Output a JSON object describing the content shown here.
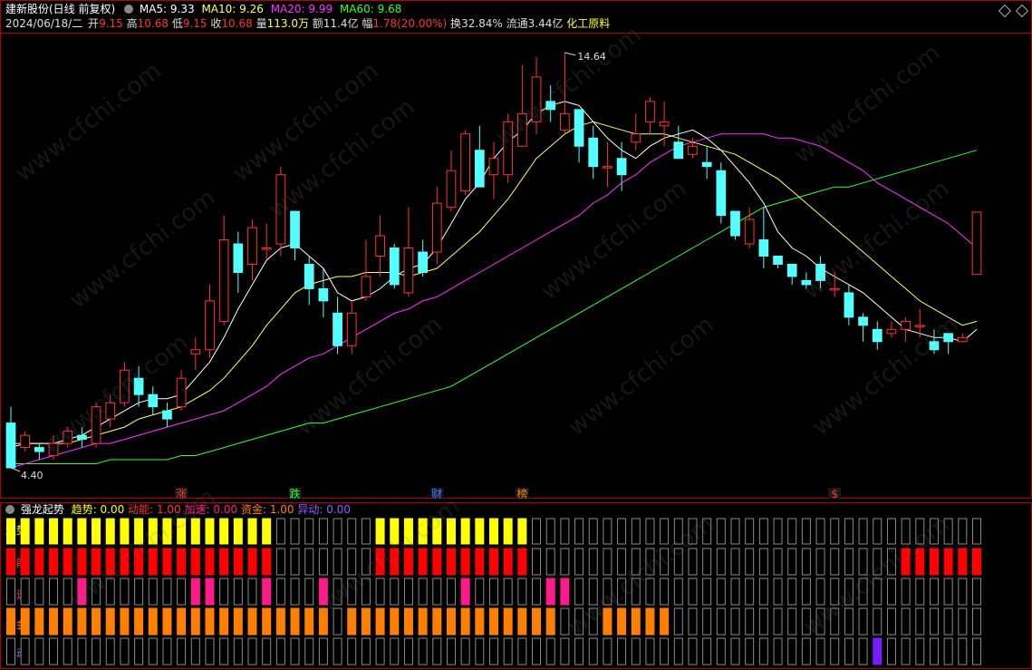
{
  "header": {
    "title": "建新股份(日线 前复权)",
    "ma5_label": "MA5: 9.33",
    "ma10_label": "MA10: 9.26",
    "ma20_label": "MA20: 9.99",
    "ma60_label": "MA60: 9.68",
    "date": "2024/06/18/二",
    "open_label": "开",
    "open": "9.15",
    "high_label": "高",
    "high": "10.68",
    "low_label": "低",
    "low": "9.15",
    "close_label": "收",
    "close": "10.68",
    "vol_label": "量",
    "vol": "113.0万",
    "amount_label": "额",
    "amount": "11.4亿",
    "change_label": "幅",
    "change": "1.78(20.00%)",
    "turnover_label": "换",
    "turnover": "32.84%",
    "float_label": "流通",
    "float": "3.44亿",
    "sector": "化工原料"
  },
  "colors": {
    "up": "#ff3232",
    "down": "#54ffff",
    "ma5": "#ffffff",
    "ma10": "#ffff66",
    "ma20": "#ff33ff",
    "ma60": "#33ff33",
    "border": "#b00000",
    "trend": "#ffff00",
    "power": "#ff0000",
    "accel": "#ff1a8c",
    "fund": "#ff8000",
    "abn": "#7a1aff"
  },
  "price_labels": {
    "max": "14.64",
    "min": "4.40"
  },
  "event_markers": [
    {
      "text": "涨",
      "color": "#ff3232",
      "bar": 12
    },
    {
      "text": "跌",
      "color": "#33ff33",
      "bar": 20
    },
    {
      "text": "财",
      "color": "#4a7aff",
      "bar": 30
    },
    {
      "text": "榜",
      "color": "#ff8000",
      "bar": 36
    },
    {
      "text": "$",
      "color": "#ff3232",
      "bar": 58
    }
  ],
  "indicator": {
    "name": "强龙起势",
    "trend_label": "趋势",
    "trend_val": "0.00",
    "power_label": "动能",
    "power_val": "1.00",
    "accel_label": "加速",
    "accel_val": "0.00",
    "fund_label": "资金",
    "fund_val": "1.00",
    "abn_label": "异动",
    "abn_val": "0.00"
  },
  "chart_data": {
    "type": "candlestick",
    "price_range": [
      4.2,
      15.0
    ],
    "candles": [
      [
        5.5,
        4.4,
        5.9,
        4.4
      ],
      [
        4.9,
        5.2,
        5.3,
        4.8
      ],
      [
        4.9,
        4.8,
        5.0,
        4.6
      ],
      [
        4.7,
        5.0,
        5.2,
        4.6
      ],
      [
        5.0,
        5.3,
        5.4,
        4.9
      ],
      [
        5.2,
        5.1,
        5.4,
        4.9
      ],
      [
        5.0,
        5.9,
        6.0,
        4.9
      ],
      [
        5.6,
        6.0,
        6.2,
        5.4
      ],
      [
        6.0,
        6.8,
        7.0,
        5.9
      ],
      [
        6.6,
        6.2,
        6.9,
        5.9
      ],
      [
        6.2,
        5.9,
        6.4,
        5.7
      ],
      [
        5.8,
        5.6,
        6.0,
        5.4
      ],
      [
        5.9,
        6.6,
        6.8,
        5.8
      ],
      [
        7.2,
        7.3,
        7.6,
        6.8
      ],
      [
        7.3,
        8.5,
        8.9,
        7.1
      ],
      [
        8.0,
        10.0,
        10.6,
        7.9
      ],
      [
        9.9,
        9.2,
        10.2,
        8.7
      ],
      [
        9.4,
        10.3,
        10.5,
        9.0
      ],
      [
        9.8,
        9.8,
        10.4,
        9.5
      ],
      [
        9.9,
        11.6,
        11.8,
        9.6
      ],
      [
        10.7,
        9.8,
        10.7,
        9.5
      ],
      [
        9.4,
        8.8,
        9.6,
        8.4
      ],
      [
        8.8,
        8.5,
        9.3,
        8.1
      ],
      [
        8.2,
        7.4,
        8.6,
        7.2
      ],
      [
        7.4,
        8.2,
        8.5,
        7.2
      ],
      [
        8.6,
        9.1,
        10.0,
        8.5
      ],
      [
        9.6,
        10.1,
        10.6,
        9.1
      ],
      [
        9.8,
        8.9,
        9.9,
        8.8
      ],
      [
        8.7,
        9.8,
        10.8,
        8.6
      ],
      [
        9.7,
        9.2,
        10.0,
        9.1
      ],
      [
        9.7,
        10.9,
        11.3,
        9.4
      ],
      [
        10.8,
        11.7,
        12.2,
        10.7
      ],
      [
        11.2,
        12.6,
        12.7,
        11.1
      ],
      [
        12.2,
        11.3,
        12.8,
        11.3
      ],
      [
        11.6,
        12.0,
        12.4,
        11.0
      ],
      [
        11.6,
        12.9,
        13.1,
        11.4
      ],
      [
        12.3,
        13.1,
        14.3,
        12.4
      ],
      [
        12.9,
        14.0,
        14.5,
        12.6
      ],
      [
        13.4,
        13.2,
        13.8,
        12.9
      ],
      [
        12.7,
        13.1,
        14.6,
        12.6
      ],
      [
        13.2,
        12.3,
        13.2,
        11.9
      ],
      [
        12.5,
        11.8,
        12.8,
        11.5
      ],
      [
        11.8,
        11.8,
        12.4,
        11.3
      ],
      [
        12.0,
        11.6,
        12.4,
        11.2
      ],
      [
        12.4,
        12.6,
        13.1,
        12.2
      ],
      [
        12.9,
        13.4,
        13.5,
        12.6
      ],
      [
        12.8,
        12.9,
        13.4,
        12.3
      ],
      [
        12.4,
        12.0,
        12.8,
        12.0
      ],
      [
        12.1,
        12.3,
        12.5,
        12.0
      ],
      [
        11.9,
        11.8,
        12.3,
        11.5
      ],
      [
        11.7,
        10.6,
        11.9,
        10.4
      ],
      [
        10.7,
        10.1,
        10.7,
        10.0
      ],
      [
        9.9,
        10.5,
        10.8,
        9.8
      ],
      [
        10.0,
        9.6,
        10.8,
        9.3
      ],
      [
        9.6,
        9.4,
        9.6,
        9.3
      ],
      [
        9.4,
        9.1,
        9.4,
        8.9
      ],
      [
        9.0,
        8.9,
        9.2,
        8.8
      ],
      [
        9.4,
        9.0,
        9.6,
        8.8
      ],
      [
        8.8,
        8.8,
        9.2,
        8.6
      ],
      [
        8.7,
        8.1,
        8.9,
        7.9
      ],
      [
        8.1,
        7.9,
        8.2,
        7.5
      ],
      [
        7.8,
        7.5,
        8.0,
        7.3
      ],
      [
        7.7,
        7.8,
        8.0,
        7.6
      ],
      [
        7.8,
        8.0,
        8.1,
        7.5
      ],
      [
        7.9,
        7.9,
        8.3,
        7.6
      ],
      [
        7.5,
        7.3,
        7.8,
        7.2
      ],
      [
        7.7,
        7.5,
        7.7,
        7.2
      ],
      [
        7.5,
        7.6,
        7.7,
        7.5
      ],
      [
        9.15,
        10.68,
        10.68,
        9.15
      ]
    ],
    "ma5": [
      4.9,
      5.0,
      5.0,
      5.0,
      5.1,
      5.2,
      5.4,
      5.6,
      5.8,
      6.0,
      6.1,
      6.1,
      6.2,
      6.6,
      7.0,
      7.6,
      8.3,
      8.9,
      9.5,
      9.8,
      9.9,
      9.6,
      9.3,
      8.7,
      8.5,
      8.6,
      8.8,
      9.1,
      9.3,
      9.4,
      9.8,
      10.4,
      11.0,
      11.4,
      12.0,
      12.4,
      12.7,
      13.1,
      13.3,
      13.4,
      13.3,
      12.9,
      12.5,
      12.2,
      12.0,
      12.3,
      12.5,
      12.6,
      12.7,
      12.5,
      12.2,
      11.8,
      11.4,
      10.9,
      10.2,
      9.8,
      9.6,
      9.3,
      9.1,
      8.9,
      8.7,
      8.4,
      8.1,
      7.8,
      7.7,
      7.6,
      7.6,
      7.5,
      7.8
    ],
    "ma10": [
      5.0,
      5.0,
      5.0,
      5.0,
      5.0,
      5.1,
      5.2,
      5.3,
      5.4,
      5.6,
      5.7,
      5.8,
      5.9,
      6.1,
      6.3,
      6.6,
      7.0,
      7.4,
      7.9,
      8.3,
      8.7,
      8.9,
      9.0,
      9.1,
      9.1,
      9.2,
      9.2,
      9.2,
      9.1,
      9.2,
      9.3,
      9.6,
      9.9,
      10.2,
      10.6,
      11.0,
      11.5,
      12.0,
      12.3,
      12.6,
      12.8,
      12.9,
      12.8,
      12.7,
      12.6,
      12.6,
      12.6,
      12.5,
      12.4,
      12.3,
      12.2,
      12.1,
      11.9,
      11.7,
      11.5,
      11.2,
      10.9,
      10.6,
      10.3,
      10.0,
      9.7,
      9.4,
      9.1,
      8.8,
      8.5,
      8.3,
      8.1,
      7.9,
      8.0
    ],
    "ma20": [
      4.4,
      4.5,
      4.6,
      4.7,
      4.8,
      4.9,
      5.0,
      5.0,
      5.1,
      5.2,
      5.3,
      5.4,
      5.5,
      5.6,
      5.7,
      5.8,
      6.0,
      6.2,
      6.4,
      6.7,
      6.9,
      7.1,
      7.2,
      7.4,
      7.6,
      7.8,
      8.0,
      8.2,
      8.3,
      8.5,
      8.6,
      8.8,
      9.0,
      9.2,
      9.4,
      9.6,
      9.8,
      10.0,
      10.2,
      10.4,
      10.6,
      10.9,
      11.1,
      11.4,
      11.6,
      11.9,
      12.1,
      12.3,
      12.4,
      12.5,
      12.6,
      12.6,
      12.6,
      12.6,
      12.5,
      12.5,
      12.4,
      12.3,
      12.1,
      11.9,
      11.7,
      11.4,
      11.2,
      11.0,
      10.8,
      10.6,
      10.4,
      10.1,
      9.8
    ],
    "ma60": [
      4.5,
      4.5,
      4.5,
      4.5,
      4.5,
      4.5,
      4.5,
      4.6,
      4.6,
      4.6,
      4.6,
      4.6,
      4.7,
      4.7,
      4.8,
      4.9,
      5.0,
      5.1,
      5.2,
      5.3,
      5.4,
      5.5,
      5.5,
      5.6,
      5.7,
      5.8,
      5.9,
      6.0,
      6.1,
      6.2,
      6.3,
      6.4,
      6.6,
      6.8,
      7.0,
      7.2,
      7.4,
      7.6,
      7.8,
      8.0,
      8.2,
      8.4,
      8.6,
      8.8,
      9.0,
      9.2,
      9.4,
      9.6,
      9.8,
      10.0,
      10.2,
      10.4,
      10.6,
      10.8,
      10.9,
      11.0,
      11.1,
      11.2,
      11.3,
      11.3,
      11.4,
      11.5,
      11.6,
      11.7,
      11.8,
      11.9,
      12.0,
      12.1,
      12.2
    ],
    "signals": {
      "trend": "11111111111111111110000000111111111110000000000000000000000000000000000",
      "power": "11111111111111111110000000111111111110000000000000000000000000011111111",
      "accel": "00000100000001100010001000000000100000110000000000000000000000000000000",
      "fund": "11111111111111111111111011111111111111100011111000000000000000000000001",
      "abn": "00000000000000000000000000000000000000000000000000000000000001000000000"
    }
  }
}
